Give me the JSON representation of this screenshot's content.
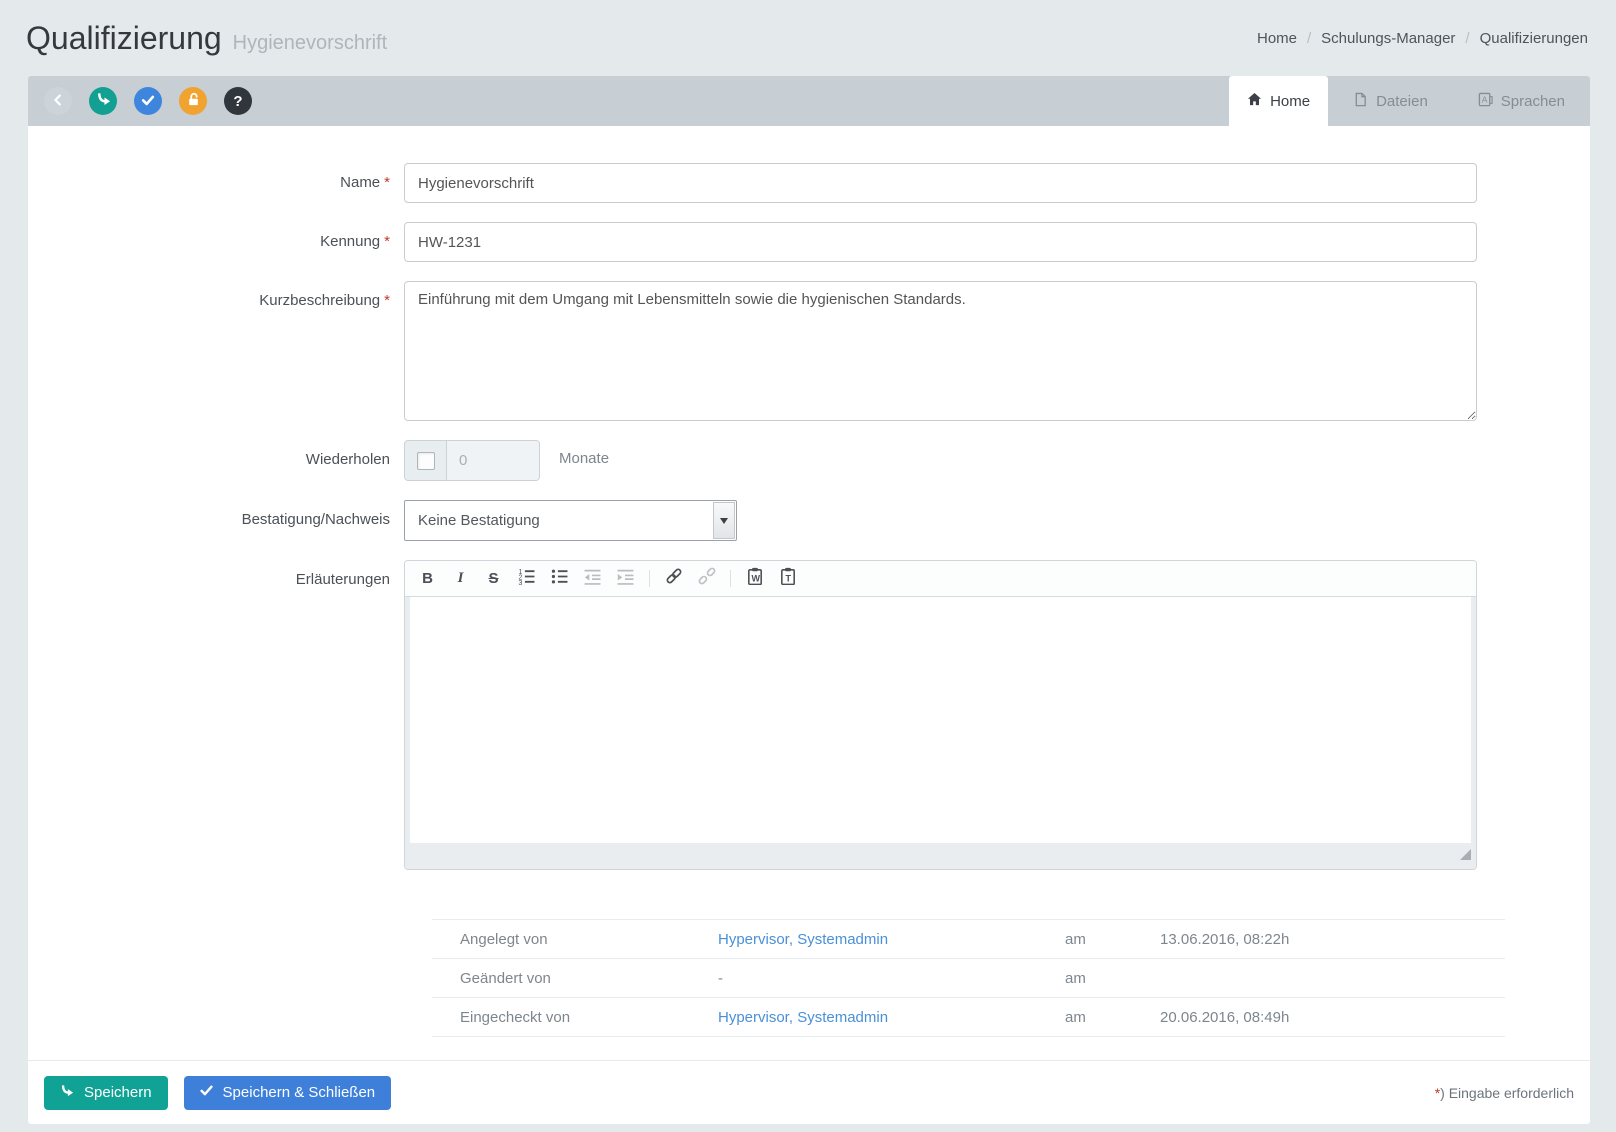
{
  "header": {
    "title": "Qualifizierung",
    "subtitle": "Hygienevorschrift",
    "breadcrumb": {
      "items": [
        "Home",
        "Schulungs-Manager",
        "Qualifizierungen"
      ],
      "separator": "/"
    }
  },
  "action_bar": {
    "buttons": [
      {
        "name": "back",
        "icon": "chevron-left-icon",
        "color": "#ccd4da"
      },
      {
        "name": "save",
        "icon": "curved-arrow-icon",
        "color": "#12a093"
      },
      {
        "name": "check-in",
        "icon": "check-icon",
        "color": "#3e86dd"
      },
      {
        "name": "unlock",
        "icon": "unlock-icon",
        "color": "#f0a32f"
      },
      {
        "name": "help",
        "icon": "question-icon",
        "glyph": "?",
        "color": "#30363c"
      }
    ]
  },
  "tabs": [
    {
      "label": "Home",
      "icon": "home-icon",
      "active": true
    },
    {
      "label": "Dateien",
      "icon": "file-icon",
      "active": false
    },
    {
      "label": "Sprachen",
      "icon": "language-icon",
      "active": false
    }
  ],
  "form": {
    "required_mark": "*",
    "name": {
      "label": "Name",
      "value": "Hygienevorschrift"
    },
    "kennung": {
      "label": "Kennung",
      "value": "HW-1231"
    },
    "kurzbeschreibung": {
      "label": "Kurzbeschreibung",
      "value": "Einführung mit dem Umgang mit Lebensmitteln sowie die hygienischen Standards."
    },
    "wiederholen": {
      "label": "Wiederholen",
      "value": "0",
      "unit": "Monate",
      "checked": false
    },
    "bestaetigung": {
      "label": "Bestatigung/Nachweis",
      "value": "Keine Bestatigung"
    },
    "erlaeuterungen": {
      "label": "Erläuterungen",
      "value": ""
    }
  },
  "editor_toolbar": {
    "glyphs": {
      "bold": "B",
      "italic": "I",
      "strikethrough": "S"
    },
    "icons": [
      "bold",
      "italic",
      "strikethrough",
      "ordered-list",
      "unordered-list",
      "outdent",
      "indent",
      "link",
      "unlink",
      "paste-from-word",
      "paste-as-text"
    ]
  },
  "meta": {
    "rows": [
      {
        "label": "Angelegt von",
        "user": "Hypervisor, Systemadmin",
        "am_label": "am",
        "date": "13.06.2016, 08:22h"
      },
      {
        "label": "Geändert von",
        "user": "-",
        "am_label": "am",
        "date": ""
      },
      {
        "label": "Eingecheckt von",
        "user": "Hypervisor, Systemadmin",
        "am_label": "am",
        "date": "20.06.2016, 08:49h"
      }
    ]
  },
  "footer": {
    "save_label": "Speichern",
    "save_close_label": "Speichern & Schließen",
    "required_mark": "*",
    "required_note": ") Eingabe erforderlich"
  },
  "colors": {
    "teal": "#0fa295",
    "blue": "#3d7fd9",
    "orange": "#f0a32f",
    "dark": "#30363c",
    "link": "#4a90d9",
    "strip": "#c7ced4"
  }
}
